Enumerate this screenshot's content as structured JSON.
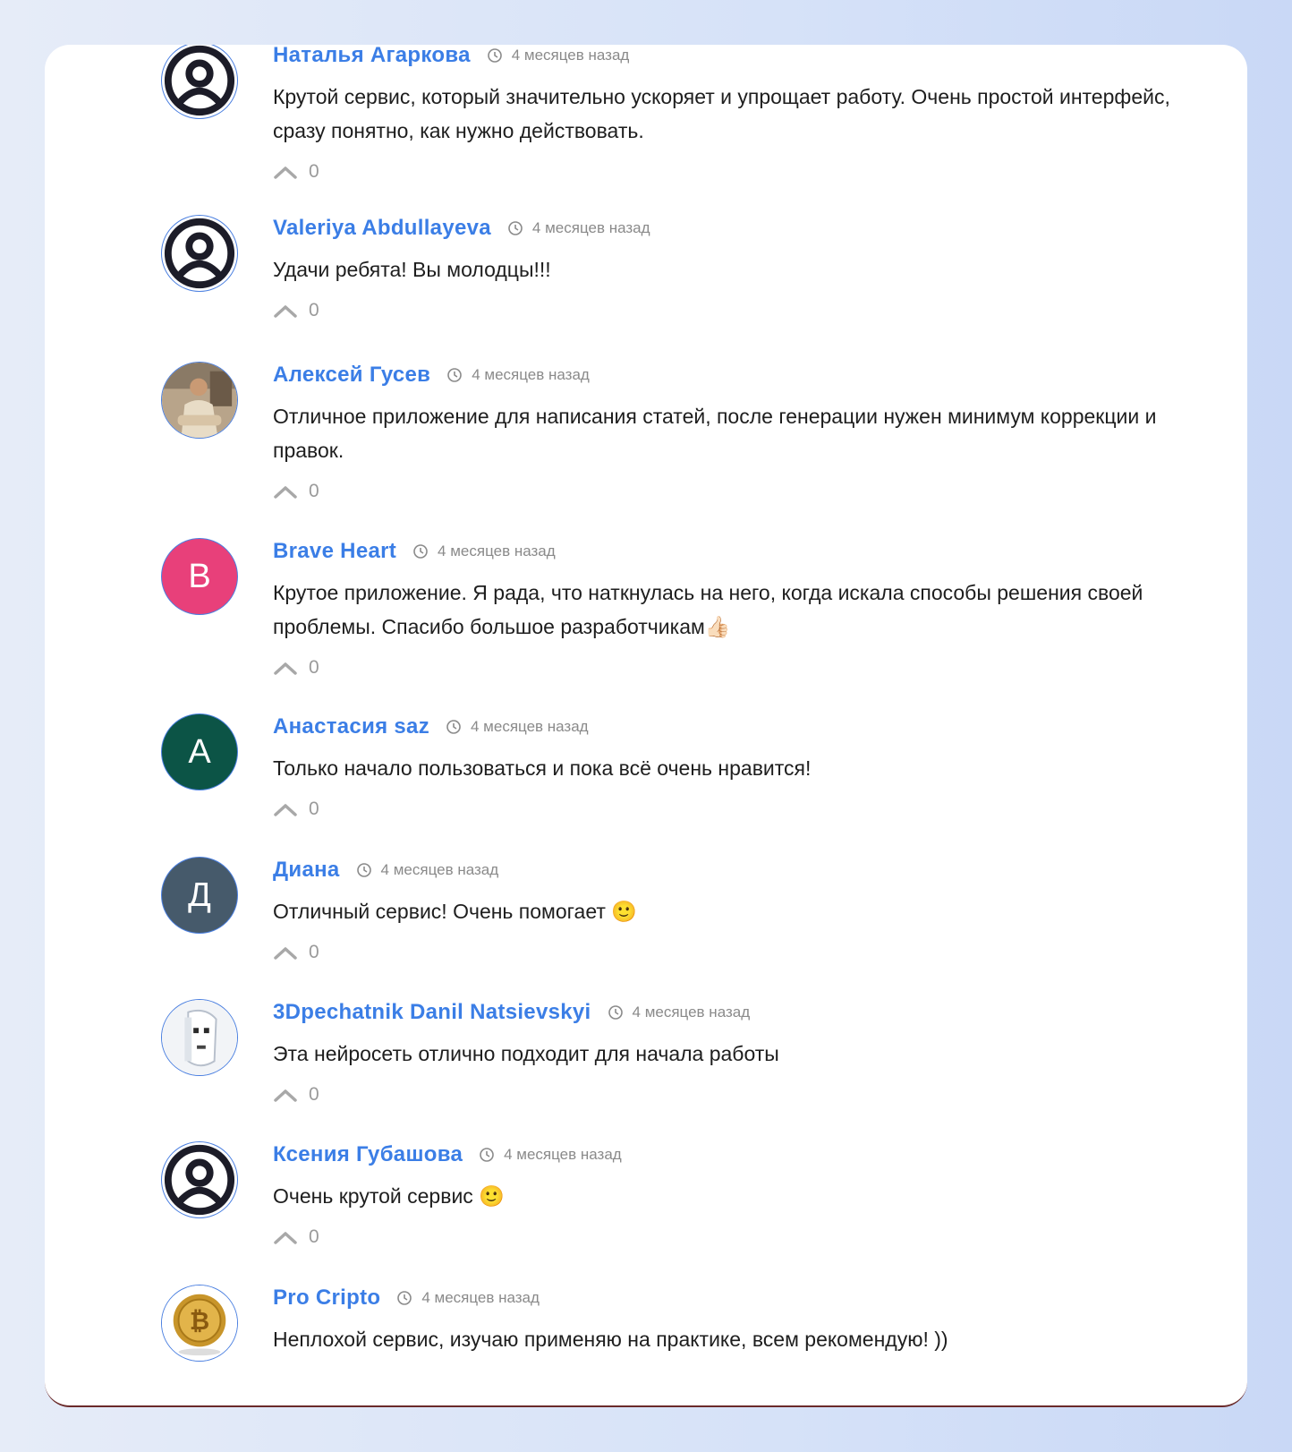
{
  "comments": [
    {
      "author": "Наталья Агаркова",
      "time": "4 месяцев назад",
      "text": "Крутой сервис, который значительно ускоряет и упрощает работу. Очень простой интерфейс, сразу понятно, как нужно действовать.",
      "votes": "0",
      "avatar": {
        "type": "user-icon"
      }
    },
    {
      "author": "Valeriya Abdullayeva",
      "time": "4 месяцев назад",
      "text": "Удачи ребята! Вы молодцы!!!",
      "votes": "0",
      "avatar": {
        "type": "user-icon"
      }
    },
    {
      "author": "Алексей Гусев",
      "time": "4 месяцев назад",
      "text": "Отличное приложение для написания статей, после генерации нужен минимум коррекции и правок.",
      "votes": "0",
      "avatar": {
        "type": "photo",
        "name": "person-photo"
      }
    },
    {
      "author": "Brave Heart",
      "time": "4 месяцев назад",
      "text": "Крутое приложение. Я рада, что наткнулась на него, когда искала способы решения своей проблемы. Спасибо большое разработчикам👍🏻",
      "votes": "0",
      "avatar": {
        "type": "letter",
        "letter": "B",
        "color": "#e8407a"
      }
    },
    {
      "author": "Анастасия saz",
      "time": "4 месяцев назад",
      "text": "Только начало пользоваться и пока всё очень нравится!",
      "votes": "0",
      "avatar": {
        "type": "letter",
        "letter": "A",
        "color": "#0c5446"
      }
    },
    {
      "author": "Диана",
      "time": "4 месяцев назад",
      "text": "Отличный сервис! Очень помогает 🙂",
      "votes": "0",
      "avatar": {
        "type": "letter",
        "letter": "Д",
        "color": "#465a6b"
      }
    },
    {
      "author": "3Dpechatnik Danil Natsievskyi",
      "time": "4 месяцев назад",
      "text": "Эта нейросеть отлично подходит для начала работы",
      "votes": "0",
      "avatar": {
        "type": "photo",
        "name": "3d-printed-mask-photo"
      }
    },
    {
      "author": "Ксения Губашова",
      "time": "4 месяцев назад",
      "text": "Очень крутой сервис 🙂",
      "votes": "0",
      "avatar": {
        "type": "user-icon"
      }
    },
    {
      "author": "Pro Cripto",
      "time": "4 месяцев назад",
      "text": "Неплохой сервис, изучаю применяю на практике, всем рекомендую! ))",
      "votes": "0",
      "avatar": {
        "type": "photo",
        "name": "bitcoin-coin-photo"
      }
    }
  ],
  "colors": {
    "author": "#3b7ee6",
    "text": "#1e1e1e",
    "meta": "#8a8a8a",
    "avatar_border": "#4a7fe0"
  }
}
